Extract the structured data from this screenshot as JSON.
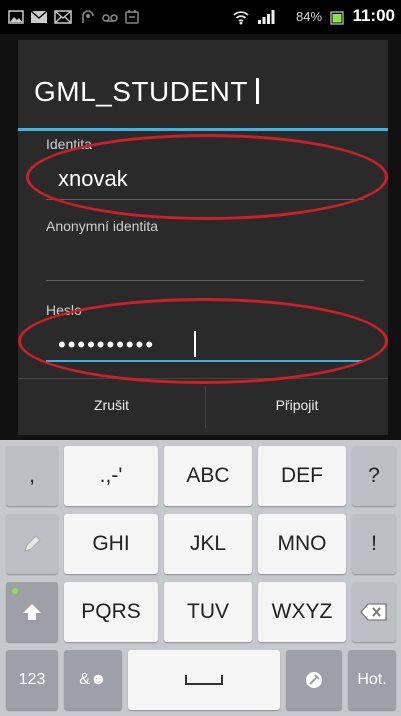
{
  "status_bar": {
    "battery": "84%",
    "time": "11:00"
  },
  "dialog": {
    "title": "GML_STUDENT",
    "fields": {
      "identity": {
        "label": "Identita",
        "value": "xnovak"
      },
      "anonymous_identity": {
        "label": "Anonymní identita",
        "value": ""
      },
      "password": {
        "label": "Heslo",
        "value": "••••••••••"
      }
    },
    "buttons": {
      "cancel": "Zrušit",
      "connect": "Připojit"
    }
  },
  "keyboard": {
    "row1": [
      ",",
      ".,-'",
      "ABC",
      "DEF",
      "?"
    ],
    "row2": [
      "GHI",
      "JKL",
      "MNO",
      "!"
    ],
    "row3": [
      "PQRS",
      "TUV",
      "WXYZ"
    ],
    "row4": {
      "numbers": "123",
      "symbols": "&☻",
      "done": "Hot."
    }
  },
  "colors": {
    "accent": "#3bb3e3",
    "annotation": "#cc2026"
  }
}
